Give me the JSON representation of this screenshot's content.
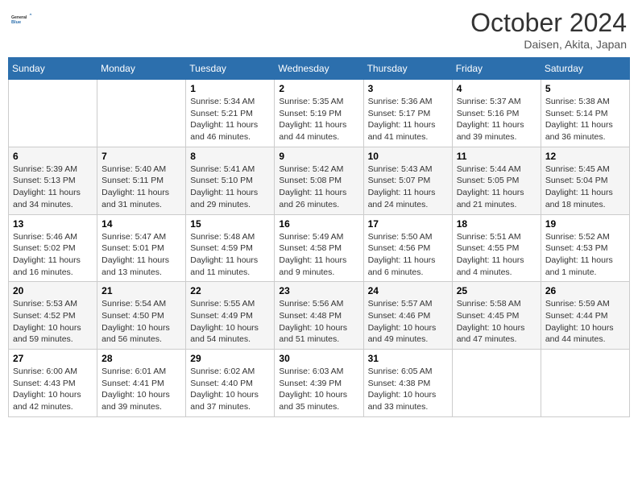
{
  "header": {
    "logo_line1": "General",
    "logo_line2": "Blue",
    "month": "October 2024",
    "location": "Daisen, Akita, Japan"
  },
  "weekdays": [
    "Sunday",
    "Monday",
    "Tuesday",
    "Wednesday",
    "Thursday",
    "Friday",
    "Saturday"
  ],
  "weeks": [
    [
      {
        "day": "",
        "content": ""
      },
      {
        "day": "",
        "content": ""
      },
      {
        "day": "1",
        "content": "Sunrise: 5:34 AM\nSunset: 5:21 PM\nDaylight: 11 hours and 46 minutes."
      },
      {
        "day": "2",
        "content": "Sunrise: 5:35 AM\nSunset: 5:19 PM\nDaylight: 11 hours and 44 minutes."
      },
      {
        "day": "3",
        "content": "Sunrise: 5:36 AM\nSunset: 5:17 PM\nDaylight: 11 hours and 41 minutes."
      },
      {
        "day": "4",
        "content": "Sunrise: 5:37 AM\nSunset: 5:16 PM\nDaylight: 11 hours and 39 minutes."
      },
      {
        "day": "5",
        "content": "Sunrise: 5:38 AM\nSunset: 5:14 PM\nDaylight: 11 hours and 36 minutes."
      }
    ],
    [
      {
        "day": "6",
        "content": "Sunrise: 5:39 AM\nSunset: 5:13 PM\nDaylight: 11 hours and 34 minutes."
      },
      {
        "day": "7",
        "content": "Sunrise: 5:40 AM\nSunset: 5:11 PM\nDaylight: 11 hours and 31 minutes."
      },
      {
        "day": "8",
        "content": "Sunrise: 5:41 AM\nSunset: 5:10 PM\nDaylight: 11 hours and 29 minutes."
      },
      {
        "day": "9",
        "content": "Sunrise: 5:42 AM\nSunset: 5:08 PM\nDaylight: 11 hours and 26 minutes."
      },
      {
        "day": "10",
        "content": "Sunrise: 5:43 AM\nSunset: 5:07 PM\nDaylight: 11 hours and 24 minutes."
      },
      {
        "day": "11",
        "content": "Sunrise: 5:44 AM\nSunset: 5:05 PM\nDaylight: 11 hours and 21 minutes."
      },
      {
        "day": "12",
        "content": "Sunrise: 5:45 AM\nSunset: 5:04 PM\nDaylight: 11 hours and 18 minutes."
      }
    ],
    [
      {
        "day": "13",
        "content": "Sunrise: 5:46 AM\nSunset: 5:02 PM\nDaylight: 11 hours and 16 minutes."
      },
      {
        "day": "14",
        "content": "Sunrise: 5:47 AM\nSunset: 5:01 PM\nDaylight: 11 hours and 13 minutes."
      },
      {
        "day": "15",
        "content": "Sunrise: 5:48 AM\nSunset: 4:59 PM\nDaylight: 11 hours and 11 minutes."
      },
      {
        "day": "16",
        "content": "Sunrise: 5:49 AM\nSunset: 4:58 PM\nDaylight: 11 hours and 9 minutes."
      },
      {
        "day": "17",
        "content": "Sunrise: 5:50 AM\nSunset: 4:56 PM\nDaylight: 11 hours and 6 minutes."
      },
      {
        "day": "18",
        "content": "Sunrise: 5:51 AM\nSunset: 4:55 PM\nDaylight: 11 hours and 4 minutes."
      },
      {
        "day": "19",
        "content": "Sunrise: 5:52 AM\nSunset: 4:53 PM\nDaylight: 11 hours and 1 minute."
      }
    ],
    [
      {
        "day": "20",
        "content": "Sunrise: 5:53 AM\nSunset: 4:52 PM\nDaylight: 10 hours and 59 minutes."
      },
      {
        "day": "21",
        "content": "Sunrise: 5:54 AM\nSunset: 4:50 PM\nDaylight: 10 hours and 56 minutes."
      },
      {
        "day": "22",
        "content": "Sunrise: 5:55 AM\nSunset: 4:49 PM\nDaylight: 10 hours and 54 minutes."
      },
      {
        "day": "23",
        "content": "Sunrise: 5:56 AM\nSunset: 4:48 PM\nDaylight: 10 hours and 51 minutes."
      },
      {
        "day": "24",
        "content": "Sunrise: 5:57 AM\nSunset: 4:46 PM\nDaylight: 10 hours and 49 minutes."
      },
      {
        "day": "25",
        "content": "Sunrise: 5:58 AM\nSunset: 4:45 PM\nDaylight: 10 hours and 47 minutes."
      },
      {
        "day": "26",
        "content": "Sunrise: 5:59 AM\nSunset: 4:44 PM\nDaylight: 10 hours and 44 minutes."
      }
    ],
    [
      {
        "day": "27",
        "content": "Sunrise: 6:00 AM\nSunset: 4:43 PM\nDaylight: 10 hours and 42 minutes."
      },
      {
        "day": "28",
        "content": "Sunrise: 6:01 AM\nSunset: 4:41 PM\nDaylight: 10 hours and 39 minutes."
      },
      {
        "day": "29",
        "content": "Sunrise: 6:02 AM\nSunset: 4:40 PM\nDaylight: 10 hours and 37 minutes."
      },
      {
        "day": "30",
        "content": "Sunrise: 6:03 AM\nSunset: 4:39 PM\nDaylight: 10 hours and 35 minutes."
      },
      {
        "day": "31",
        "content": "Sunrise: 6:05 AM\nSunset: 4:38 PM\nDaylight: 10 hours and 33 minutes."
      },
      {
        "day": "",
        "content": ""
      },
      {
        "day": "",
        "content": ""
      }
    ]
  ]
}
